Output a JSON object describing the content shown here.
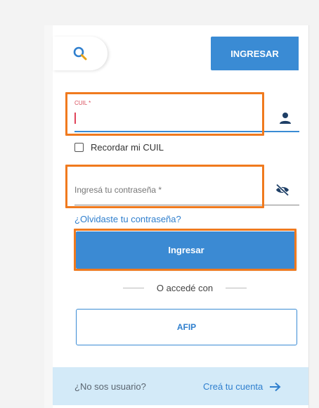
{
  "header": {
    "search_icon": "search-icon",
    "login_button": "INGRESAR"
  },
  "form": {
    "cuil": {
      "label": "CUIL *",
      "value": "",
      "icon": "user-icon"
    },
    "remember_label": "Recordar mi CUIL",
    "remember_checked": false,
    "password": {
      "placeholder": "Ingresá tu contraseña *",
      "value": "",
      "icon": "eye-slash-icon"
    },
    "forgot_link": "¿Olvidaste tu contraseña?",
    "submit_label": "Ingresar",
    "divider_text": "O accedé con",
    "afip_label": "AFIP"
  },
  "footer": {
    "question": "¿No sos usuario?",
    "create_link": "Creá tu cuenta",
    "arrow_icon": "arrow-right-icon"
  },
  "colors": {
    "primary": "#3a8bd4",
    "highlight": "#f07a1e",
    "error": "#d94f5c",
    "footer_bg": "#d3eaf8"
  }
}
